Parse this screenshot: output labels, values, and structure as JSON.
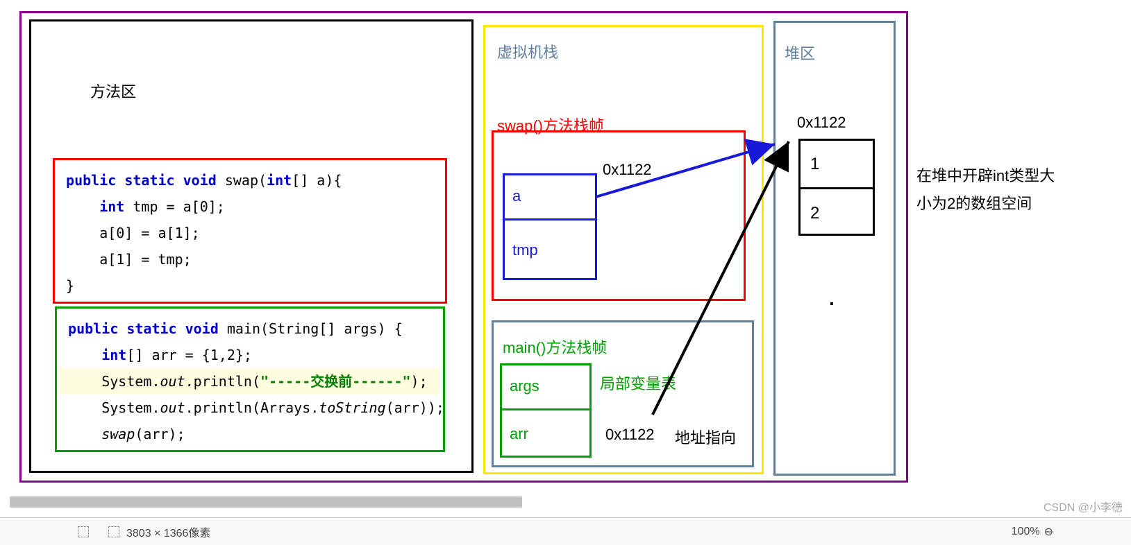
{
  "methodArea": {
    "title": "方法区",
    "swapCode": [
      {
        "tokens": [
          {
            "t": " ",
            "c": ""
          },
          {
            "t": "public static void",
            "c": "kw"
          },
          {
            "t": " swap(",
            "c": ""
          },
          {
            "t": "int",
            "c": "kw"
          },
          {
            "t": "[] a){",
            "c": ""
          }
        ]
      },
      {
        "tokens": [
          {
            "t": "     ",
            "c": ""
          },
          {
            "t": "int",
            "c": "kw"
          },
          {
            "t": " tmp = a[0];",
            "c": ""
          }
        ]
      },
      {
        "tokens": [
          {
            "t": "     a[0] = a[1];",
            "c": ""
          }
        ]
      },
      {
        "tokens": [
          {
            "t": "     a[1] = tmp;",
            "c": ""
          }
        ]
      },
      {
        "tokens": [
          {
            "t": " }",
            "c": ""
          }
        ]
      }
    ],
    "mainCode": [
      {
        "tokens": [
          {
            "t": " ",
            "c": ""
          },
          {
            "t": "public static void",
            "c": "kw"
          },
          {
            "t": " main(String[] args) {",
            "c": ""
          }
        ]
      },
      {
        "tokens": [
          {
            "t": "     ",
            "c": ""
          },
          {
            "t": "int",
            "c": "kw"
          },
          {
            "t": "[] arr = {1,2};",
            "c": ""
          }
        ]
      },
      {
        "hl": true,
        "tokens": [
          {
            "t": "     System.",
            "c": ""
          },
          {
            "t": "out",
            "c": "it"
          },
          {
            "t": ".println(",
            "c": ""
          },
          {
            "t": "\"-----交换前------\"",
            "c": "str"
          },
          {
            "t": ");",
            "c": ""
          }
        ]
      },
      {
        "tokens": [
          {
            "t": "     System.",
            "c": ""
          },
          {
            "t": "out",
            "c": "it"
          },
          {
            "t": ".println(Arrays.",
            "c": ""
          },
          {
            "t": "toString",
            "c": "it"
          },
          {
            "t": "(arr));",
            "c": ""
          }
        ]
      },
      {
        "tokens": [
          {
            "t": "     ",
            "c": ""
          },
          {
            "t": "swap",
            "c": "it"
          },
          {
            "t": "(arr);",
            "c": ""
          }
        ]
      }
    ]
  },
  "stack": {
    "title": "虚拟机栈",
    "swapFrame": {
      "title": "swap()方法栈帧",
      "varA": "a",
      "varTmp": "tmp",
      "address": "0x1122"
    },
    "mainFrame": {
      "title": "main()方法栈帧",
      "varArgs": "args",
      "varArr": "arr",
      "address": "0x1122",
      "localVarLabel": "局部变量表",
      "addrLabel": "地址指向"
    }
  },
  "heap": {
    "title": "堆区",
    "address": "0x1122",
    "cell1": "1",
    "cell2": "2",
    "dot": "·"
  },
  "annotation": {
    "line1": "在堆中开辟int类型大",
    "line2": "小为2的数组空间"
  },
  "statusbar": {
    "dimensions": "3803 × 1366像素",
    "zoom": "100%"
  },
  "watermark": "CSDN @小李德"
}
